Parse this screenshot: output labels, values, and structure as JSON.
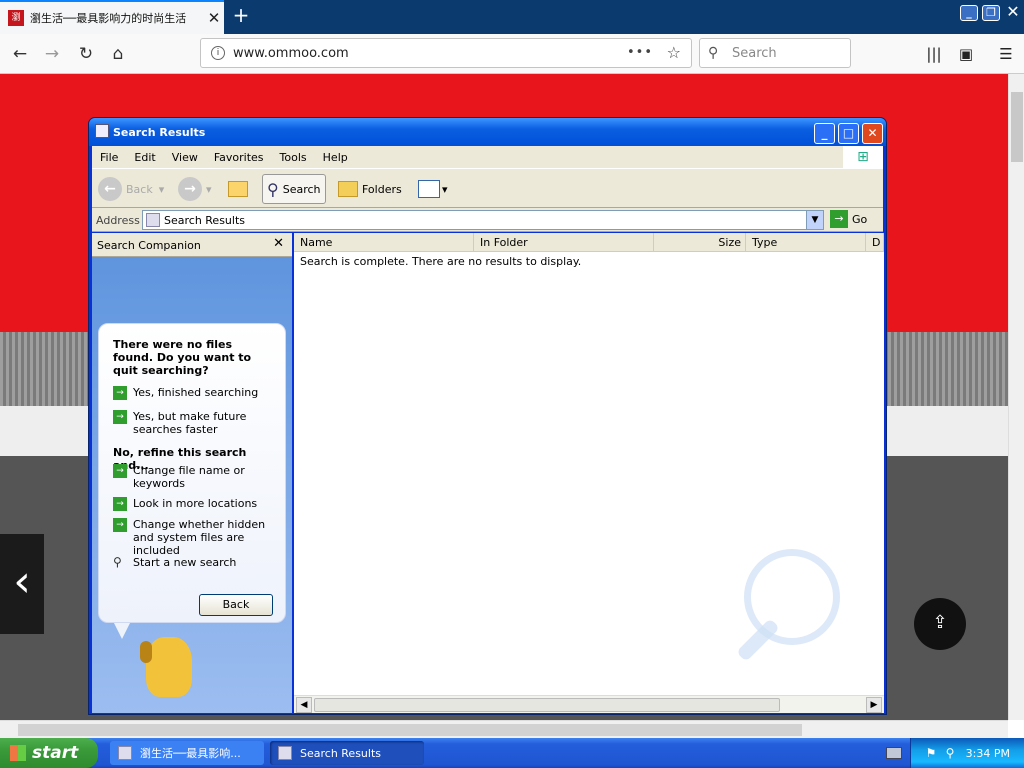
{
  "browser": {
    "tab_title": "瀏生活──最具影响力的时尚生活",
    "favicon_text": "瀏",
    "url": "www.ommoo.com",
    "search_placeholder": "Search",
    "page_action_dots": "•••",
    "icons": [
      "back-icon",
      "forward-icon",
      "reload-icon",
      "home-icon",
      "info-icon",
      "bookmark-star-icon",
      "search-icon",
      "library-icon",
      "sidebar-icon",
      "menu-icon"
    ]
  },
  "explorer": {
    "title": "Search Results",
    "menu": [
      "File",
      "Edit",
      "View",
      "Favorites",
      "Tools",
      "Help"
    ],
    "toolbar": {
      "back": "Back",
      "search": "Search",
      "folders": "Folders"
    },
    "address_label": "Address",
    "address_value": "Search Results",
    "go_label": "Go",
    "companion": {
      "header": "Search Companion",
      "question": "There were no files found. Do you want to quit searching?",
      "options_quit": [
        "Yes, finished searching",
        "Yes, but make future searches faster"
      ],
      "refine_heading": "No, refine this search and...",
      "options_refine": [
        "Change file name or keywords",
        "Look in more locations",
        "Change whether hidden and system files are included"
      ],
      "new_search": "Start a new search",
      "back_button": "Back"
    },
    "columns": [
      "Name",
      "In Folder",
      "Size",
      "Type",
      "D"
    ],
    "message": "Search is complete. There are no results to display."
  },
  "taskbar": {
    "start_label": "start",
    "tasks": [
      "瀏生活──最具影响...",
      "Search Results"
    ],
    "clock": "3:34 PM"
  },
  "colors": {
    "xp_blue": "#0a5ee0",
    "page_red": "#e8161c",
    "start_green": "#3a9a3a"
  }
}
